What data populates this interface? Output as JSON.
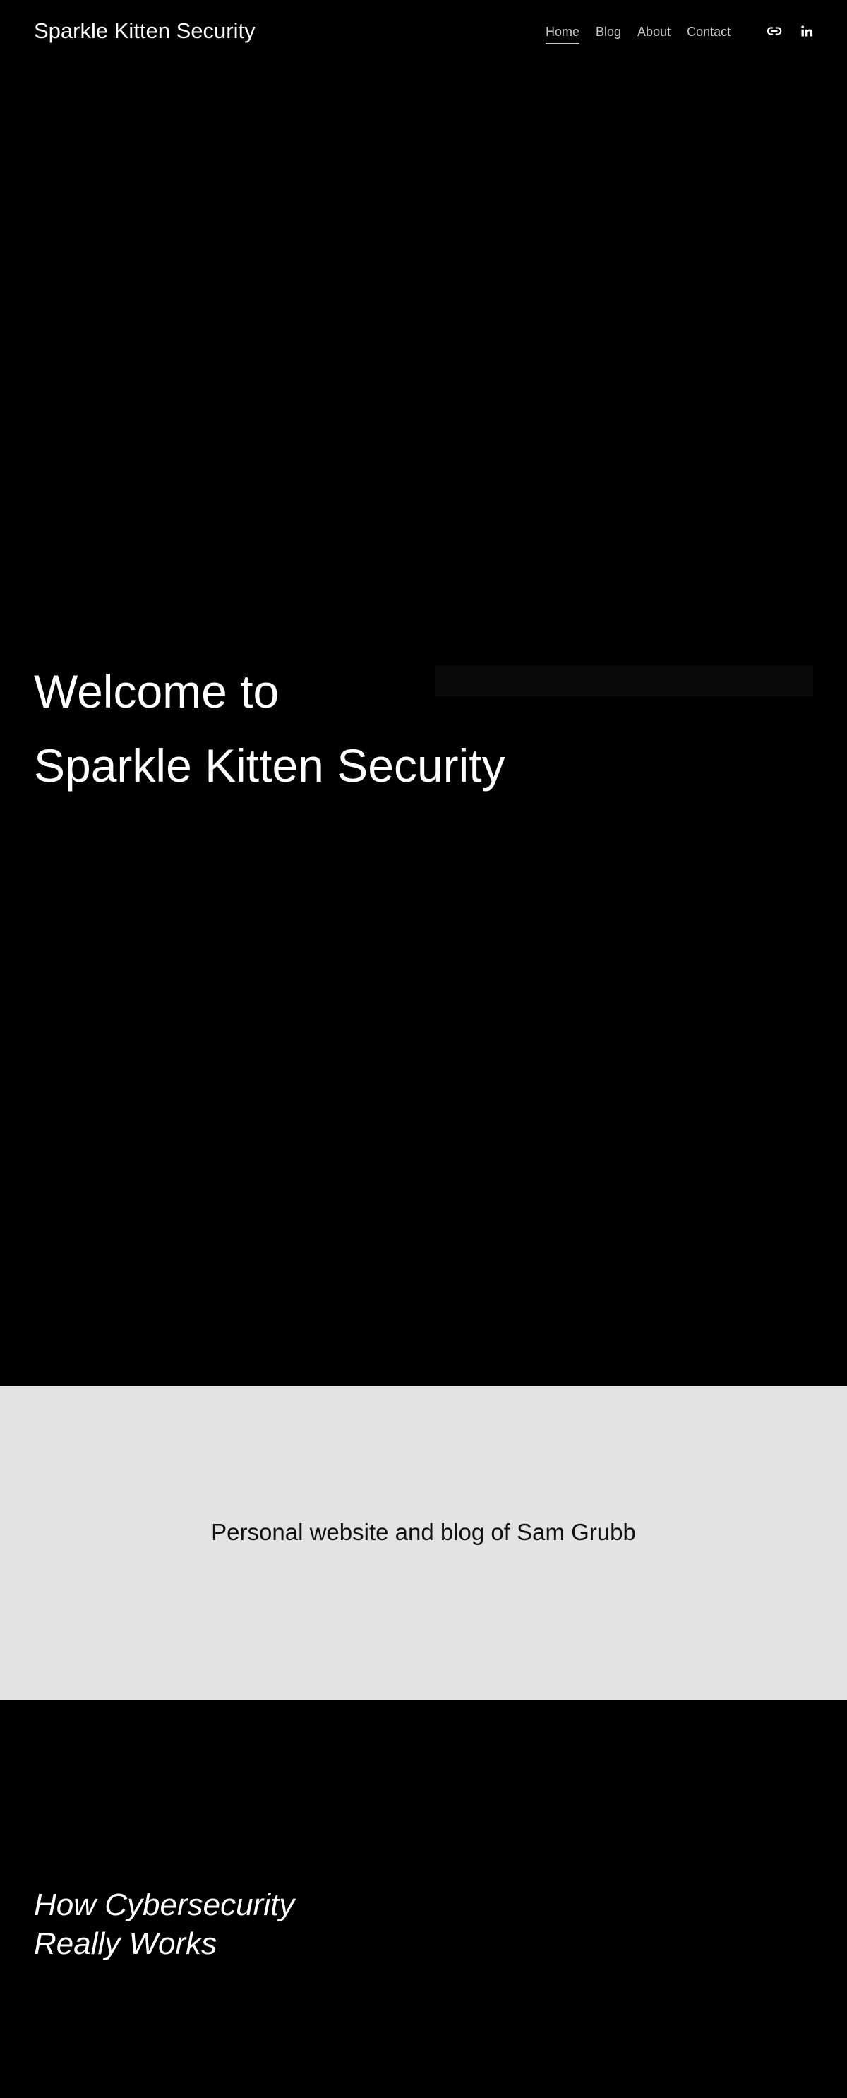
{
  "header": {
    "site_title": "Sparkle Kitten Security",
    "nav": [
      {
        "label": "Home",
        "active": true
      },
      {
        "label": "Blog",
        "active": false
      },
      {
        "label": "About",
        "active": false
      },
      {
        "label": "Contact",
        "active": false
      }
    ],
    "social_icons": [
      "link-icon",
      "linkedin-icon"
    ]
  },
  "hero": {
    "line1": "Welcome to",
    "line2": "Sparkle Kitten Security"
  },
  "band": {
    "text": "Personal website and blog of Sam Grubb"
  },
  "bottom": {
    "heading_line1": "How Cybersecurity",
    "heading_line2": "Really Works"
  },
  "colors": {
    "background": "#000000",
    "band_background": "#e3e3e3",
    "text_light": "#ffffff",
    "nav_text": "#c9c9c9",
    "text_dark": "#111111"
  }
}
